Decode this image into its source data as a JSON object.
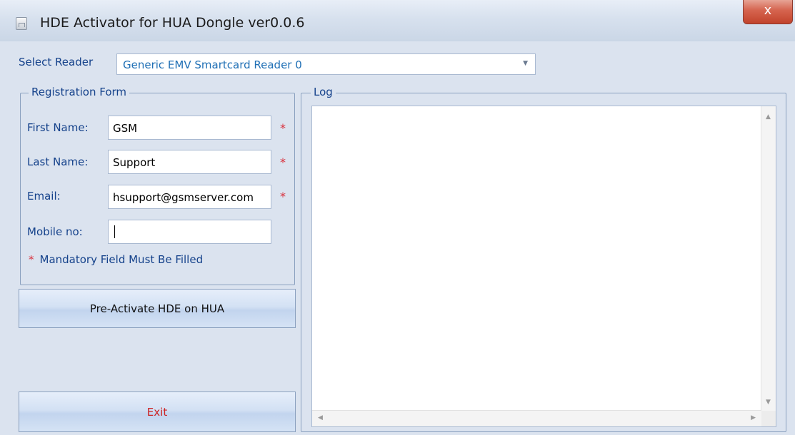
{
  "window": {
    "title": "HDE Activator for HUA Dongle ver0.0.6",
    "close_glyph": "x"
  },
  "reader": {
    "label": "Select Reader",
    "selected": "Generic EMV Smartcard Reader 0"
  },
  "registration": {
    "group_title": "Registration Form",
    "fields": [
      {
        "label": "First Name:",
        "value": "GSM",
        "mandatory": "*"
      },
      {
        "label": "Last Name:",
        "value": "Support",
        "mandatory": "*"
      },
      {
        "label": "Email:",
        "value": "hsupport@gsmserver.com",
        "mandatory": "*"
      },
      {
        "label": "Mobile no:",
        "value": ""
      }
    ],
    "note_star": "*",
    "note_text": "Mandatory Field  Must Be Filled"
  },
  "buttons": {
    "preactivate_label": "Pre-Activate HDE on HUA",
    "exit_label": "Exit"
  },
  "log": {
    "group_title": "Log"
  },
  "colors": {
    "label_blue": "#15428b",
    "asterisk_red": "#d9303c",
    "exit_red": "#cc2222",
    "combo_text": "#1f6fb5"
  },
  "icons": [
    "app-icon",
    "close-icon",
    "dropdown-arrow-icon",
    "scroll-up-icon",
    "scroll-down-icon",
    "scroll-left-icon",
    "scroll-right-icon"
  ]
}
